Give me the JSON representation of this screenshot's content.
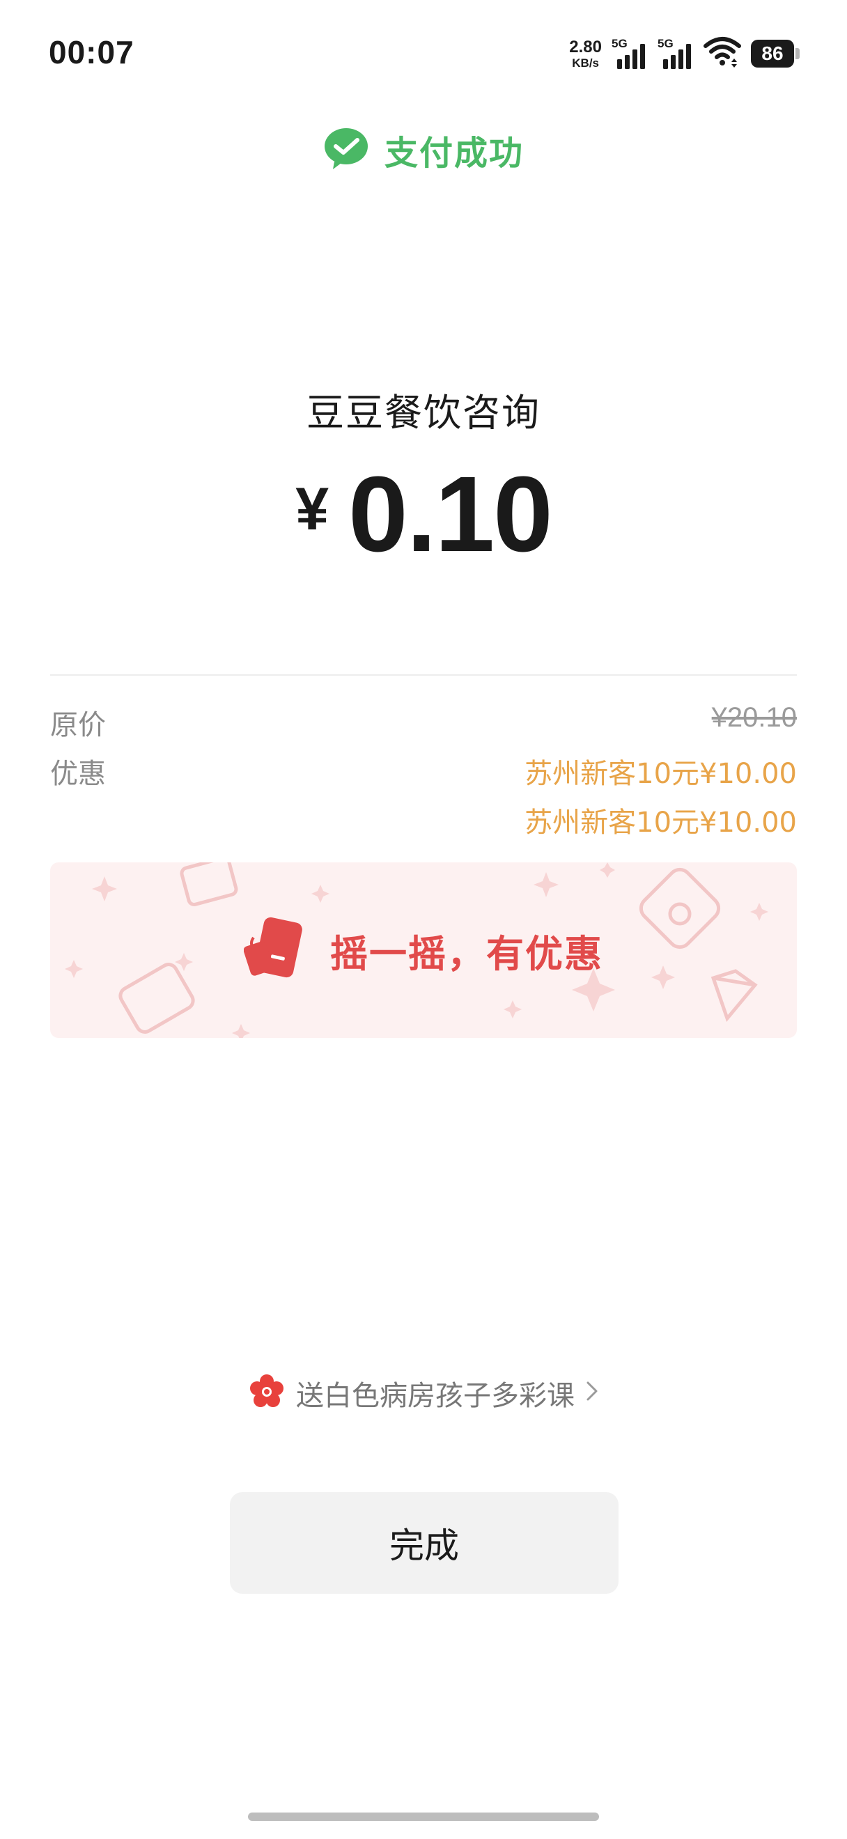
{
  "status_bar": {
    "time": "00:07",
    "net_speed_value": "2.80",
    "net_speed_unit": "KB/s",
    "sim1_tag": "5G",
    "sim2_tag": "5G",
    "battery_level": "86",
    "icons": [
      "signal-icon",
      "wifi-icon",
      "battery-icon"
    ]
  },
  "header": {
    "status_text": "支付成功",
    "icon": "wechat-check-icon",
    "accent_color": "#4ab865"
  },
  "payment": {
    "merchant": "豆豆餐饮咨询",
    "currency": "¥",
    "amount": "0.10"
  },
  "details": {
    "original_label": "原价",
    "original_value": "¥20.10",
    "discount_label": "优惠",
    "discounts": [
      "苏州新客10元¥10.00",
      "苏州新客10元¥10.00"
    ],
    "discount_color": "#e8a449"
  },
  "promo": {
    "text": "摇一摇，有优惠",
    "icon": "shake-phone-icon",
    "color": "#e14a4a"
  },
  "charity": {
    "text": "送白色病房孩子多彩课",
    "icon": "flower-icon",
    "chevron": "chevron-right-icon"
  },
  "actions": {
    "done_label": "完成"
  }
}
